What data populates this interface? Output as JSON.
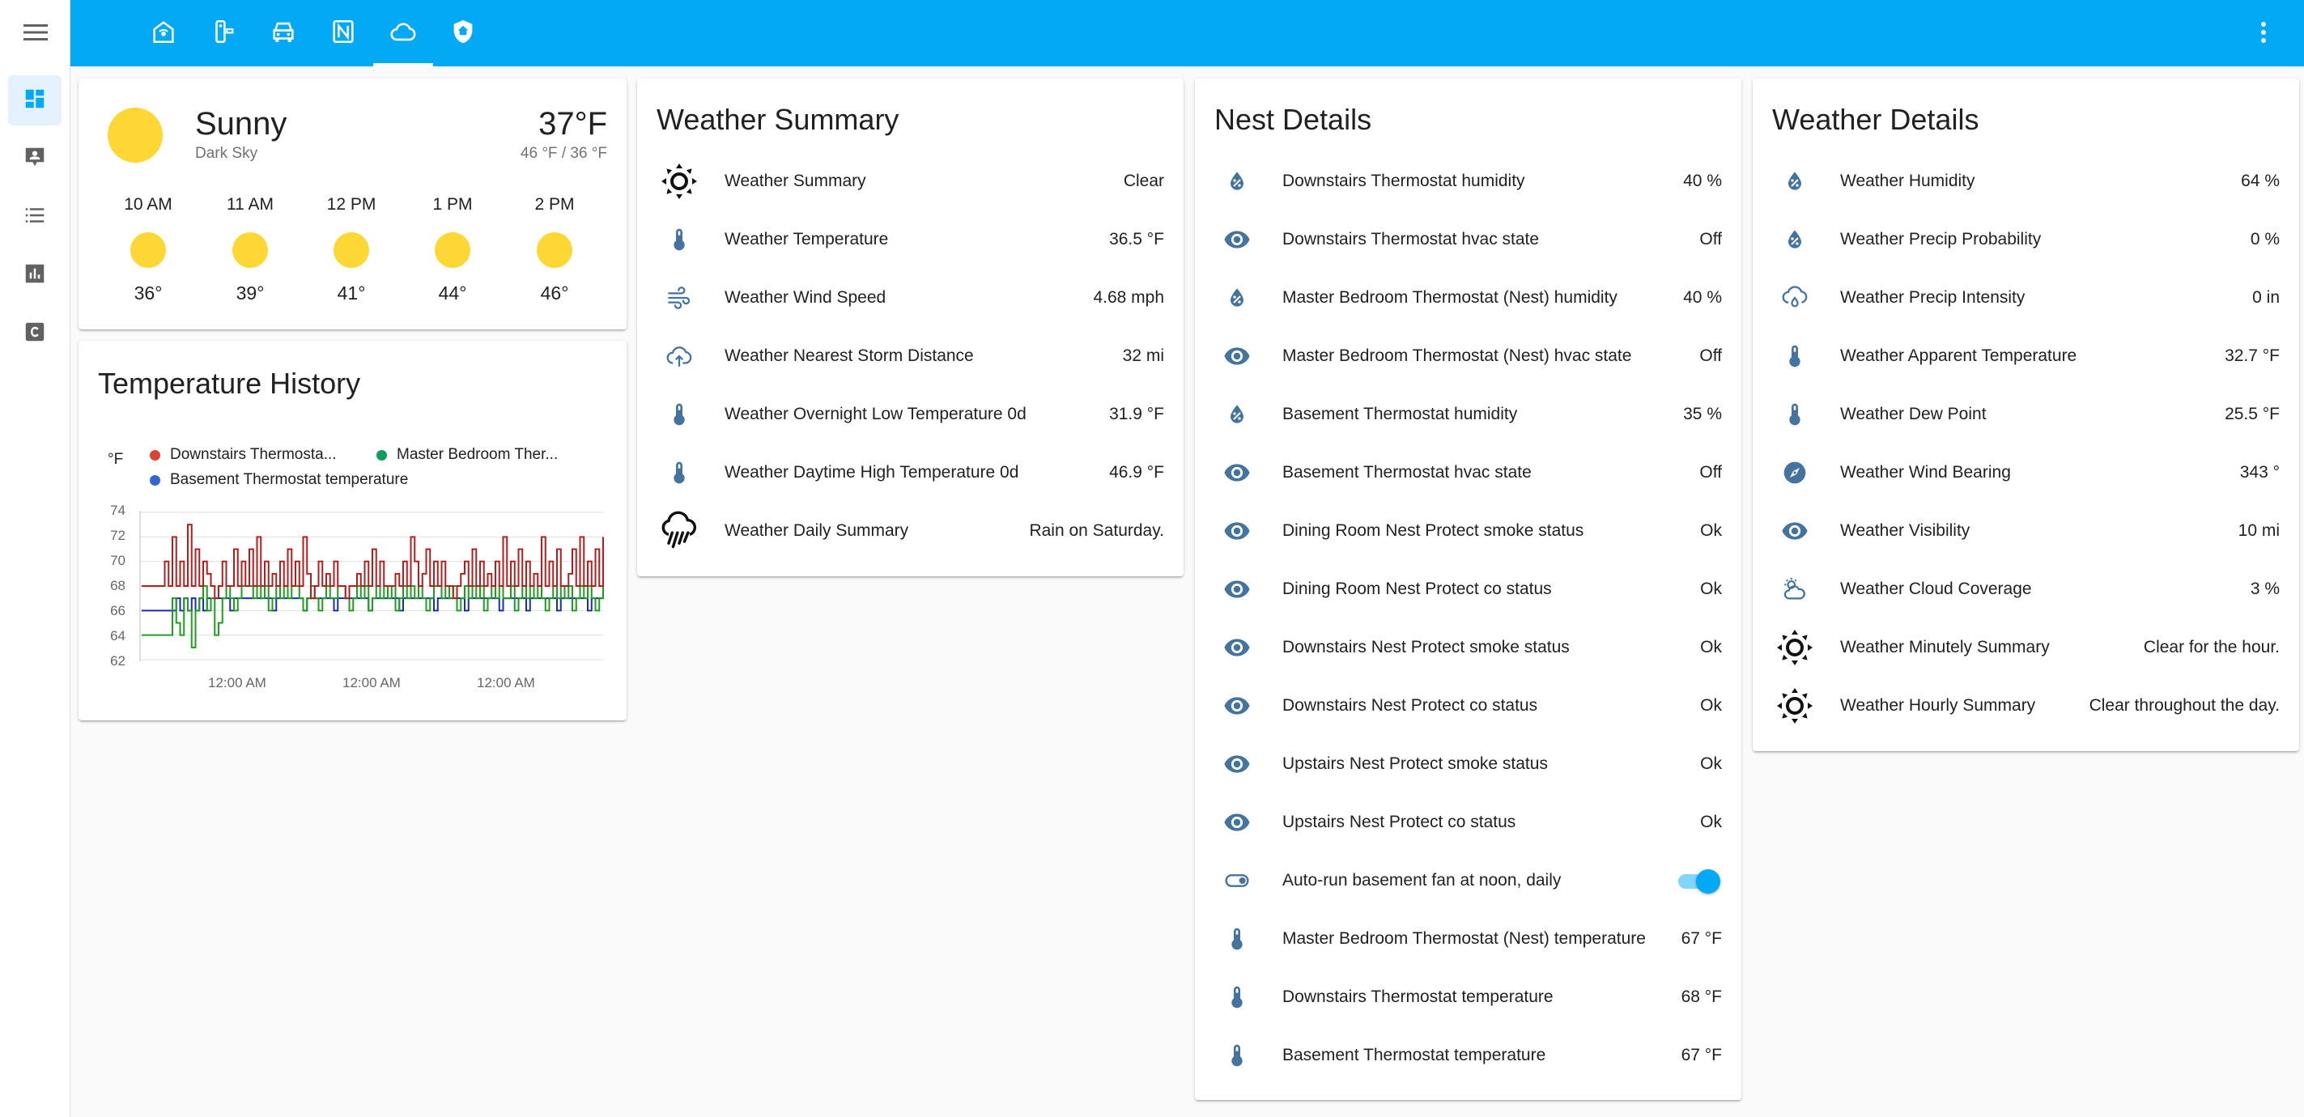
{
  "header": {
    "tabs": [
      {
        "icon": "home-automation-icon",
        "active": false
      },
      {
        "icon": "remote-icon",
        "active": false
      },
      {
        "icon": "car-icon",
        "active": false
      },
      {
        "icon": "nfc-icon",
        "active": false
      },
      {
        "icon": "cloud-icon",
        "active": true
      },
      {
        "icon": "shield-home-icon",
        "active": false
      }
    ]
  },
  "sidebar": {
    "items": [
      {
        "icon": "dashboard-icon",
        "active": true
      },
      {
        "icon": "account-box-icon",
        "active": false
      },
      {
        "icon": "list-icon",
        "active": false
      },
      {
        "icon": "chart-bar-icon",
        "active": false
      },
      {
        "icon": "letter-c-icon",
        "active": false
      }
    ]
  },
  "weather_forecast": {
    "state": "Sunny",
    "attribution": "Dark Sky",
    "temperature": "37°F",
    "hilo": "46 °F / 36 °F",
    "forecast": [
      {
        "time": "10 AM",
        "temp": "36°"
      },
      {
        "time": "11 AM",
        "temp": "39°"
      },
      {
        "time": "12 PM",
        "temp": "41°"
      },
      {
        "time": "1 PM",
        "temp": "44°"
      },
      {
        "time": "2 PM",
        "temp": "46°"
      }
    ]
  },
  "temperature_history": {
    "title": "Temperature History",
    "unit": "°F",
    "legend": [
      {
        "name": "Downstairs Thermosta...",
        "color": "#db4437"
      },
      {
        "name": "Master Bedroom Ther...",
        "color": "#0f9d58"
      },
      {
        "name": "Basement Thermostat temperature",
        "color": "#3366cc"
      }
    ]
  },
  "chart_data": {
    "type": "line",
    "ylim": [
      62,
      74
    ],
    "yticks": [
      "74",
      "72",
      "70",
      "68",
      "66",
      "64",
      "62"
    ],
    "xticks": [
      "12:00 AM",
      "12:00 AM",
      "12:00 AM"
    ],
    "series": [
      {
        "name": "Downstairs Thermosta...",
        "color": "#b71c1c",
        "values": [
          68,
          68,
          68,
          68,
          68,
          68,
          70,
          68,
          72,
          68,
          70,
          68,
          73,
          68,
          71,
          68,
          70,
          69,
          68,
          67,
          68,
          70,
          68,
          68,
          71,
          68,
          70,
          68,
          71,
          68,
          72,
          68,
          70,
          68,
          69,
          68,
          70,
          68,
          71,
          68,
          70,
          68,
          72,
          69,
          67,
          68,
          70,
          68,
          69,
          68,
          70,
          68,
          68,
          67,
          68,
          68,
          69,
          68,
          70,
          68,
          71,
          68,
          70,
          68,
          68,
          68,
          69,
          68,
          70,
          68,
          72,
          70,
          68,
          69,
          71,
          68,
          70,
          68,
          70,
          68,
          68,
          67,
          68,
          69,
          70,
          68,
          71,
          68,
          70,
          68,
          69,
          68,
          70,
          68,
          72,
          68,
          70,
          68,
          71,
          68,
          70,
          68,
          69,
          68,
          72,
          68,
          70,
          68,
          71,
          68,
          68,
          69,
          71,
          68,
          72,
          68,
          70,
          68,
          71,
          68,
          72
        ]
      },
      {
        "name": "Master Bedroom Ther...",
        "color": "#1e9e1e",
        "values": [
          64,
          64,
          64,
          64,
          64,
          64,
          64,
          64,
          67,
          65,
          64,
          67,
          66,
          63,
          66,
          67,
          68,
          66,
          67,
          64,
          65,
          67,
          68,
          67,
          66,
          67,
          68,
          68,
          68,
          67,
          68,
          67,
          68,
          66,
          67,
          68,
          67,
          68,
          67,
          68,
          68,
          67,
          66,
          67,
          68,
          67,
          66,
          67,
          68,
          67,
          67,
          68,
          68,
          67,
          66,
          67,
          68,
          67,
          68,
          66,
          67,
          68,
          67,
          68,
          67,
          68,
          66,
          67,
          68,
          67,
          68,
          67,
          68,
          67,
          66,
          67,
          68,
          68,
          67,
          68,
          67,
          68,
          66,
          67,
          68,
          67,
          68,
          67,
          68,
          66,
          67,
          68,
          67,
          68,
          67,
          67,
          68,
          66,
          67,
          68,
          67,
          68,
          67,
          68,
          67,
          66,
          67,
          68,
          67,
          68,
          67,
          68,
          66,
          67,
          68,
          67,
          68,
          67,
          66,
          67,
          68
        ]
      },
      {
        "name": "Basement Thermostat temperature",
        "color": "#1a2bb5",
        "values": [
          66,
          66,
          66,
          66,
          66,
          66,
          66,
          66,
          66,
          67,
          66,
          67,
          66,
          67,
          66,
          67,
          66,
          67,
          67,
          67,
          67,
          67,
          67,
          66,
          67,
          67,
          67,
          67,
          67,
          67,
          67,
          67,
          67,
          67,
          66,
          67,
          67,
          67,
          67,
          67,
          67,
          67,
          66,
          67,
          67,
          67,
          67,
          67,
          67,
          67,
          66,
          67,
          67,
          67,
          67,
          67,
          67,
          67,
          67,
          66,
          67,
          67,
          67,
          67,
          67,
          67,
          67,
          66,
          67,
          67,
          67,
          67,
          67,
          67,
          67,
          67,
          66,
          67,
          67,
          67,
          67,
          67,
          67,
          67,
          66,
          67,
          67,
          67,
          67,
          67,
          67,
          67,
          67,
          66,
          67,
          67,
          67,
          67,
          67,
          67,
          66,
          67,
          67,
          67,
          67,
          67,
          67,
          67,
          66,
          67,
          67,
          67,
          67,
          67,
          67,
          67,
          66,
          67,
          67,
          67,
          67
        ]
      }
    ]
  },
  "weather_summary": {
    "title": "Weather Summary",
    "rows": [
      {
        "icon": "sunny-icon",
        "name": "Weather Summary",
        "value": "Clear"
      },
      {
        "icon": "thermometer-icon",
        "name": "Weather Temperature",
        "value": "36.5 °F"
      },
      {
        "icon": "wind-icon",
        "name": "Weather Wind Speed",
        "value": "4.68 mph"
      },
      {
        "icon": "cloud-upload-icon",
        "name": "Weather Nearest Storm Distance",
        "value": "32 mi"
      },
      {
        "icon": "thermometer-icon",
        "name": "Weather Overnight Low Temperature 0d",
        "value": "31.9 °F"
      },
      {
        "icon": "thermometer-icon",
        "name": "Weather Daytime High Temperature 0d",
        "value": "46.9 °F"
      },
      {
        "icon": "rainy-icon",
        "name": "Weather Daily Summary",
        "value": "Rain on Saturday."
      }
    ]
  },
  "nest_details": {
    "title": "Nest Details",
    "rows": [
      {
        "icon": "water-percent-icon",
        "name": "Downstairs Thermostat humidity",
        "value": "40 %"
      },
      {
        "icon": "eye-icon",
        "name": "Downstairs Thermostat hvac state",
        "value": "Off"
      },
      {
        "icon": "water-percent-icon",
        "name": "Master Bedroom Thermostat (Nest) humidity",
        "value": "40 %"
      },
      {
        "icon": "eye-icon",
        "name": "Master Bedroom Thermostat (Nest) hvac state",
        "value": "Off"
      },
      {
        "icon": "water-percent-icon",
        "name": "Basement Thermostat humidity",
        "value": "35 %"
      },
      {
        "icon": "eye-icon",
        "name": "Basement Thermostat hvac state",
        "value": "Off"
      },
      {
        "icon": "eye-icon",
        "name": "Dining Room Nest Protect smoke status",
        "value": "Ok"
      },
      {
        "icon": "eye-icon",
        "name": "Dining Room Nest Protect co status",
        "value": "Ok"
      },
      {
        "icon": "eye-icon",
        "name": "Downstairs Nest Protect smoke status",
        "value": "Ok"
      },
      {
        "icon": "eye-icon",
        "name": "Downstairs Nest Protect co status",
        "value": "Ok"
      },
      {
        "icon": "eye-icon",
        "name": "Upstairs Nest Protect smoke status",
        "value": "Ok"
      },
      {
        "icon": "eye-icon",
        "name": "Upstairs Nest Protect co status",
        "value": "Ok"
      },
      {
        "icon": "toggle-switch-icon",
        "name": "Auto-run basement fan at noon, daily",
        "value": "",
        "toggle": true
      },
      {
        "icon": "thermometer-icon",
        "name": "Master Bedroom Thermostat (Nest) temperature",
        "value": "67 °F"
      },
      {
        "icon": "thermometer-icon",
        "name": "Downstairs Thermostat temperature",
        "value": "68 °F"
      },
      {
        "icon": "thermometer-icon",
        "name": "Basement Thermostat temperature",
        "value": "67 °F"
      }
    ]
  },
  "weather_details": {
    "title": "Weather Details",
    "rows": [
      {
        "icon": "water-percent-icon",
        "name": "Weather Humidity",
        "value": "64 %"
      },
      {
        "icon": "water-percent-icon",
        "name": "Weather Precip Probability",
        "value": "0 %"
      },
      {
        "icon": "weather-rainy-icon",
        "name": "Weather Precip Intensity",
        "value": "0 in"
      },
      {
        "icon": "thermometer-icon",
        "name": "Weather Apparent Temperature",
        "value": "32.7 °F"
      },
      {
        "icon": "thermometer-icon",
        "name": "Weather Dew Point",
        "value": "25.5 °F"
      },
      {
        "icon": "compass-icon",
        "name": "Weather Wind Bearing",
        "value": "343 °"
      },
      {
        "icon": "eye-icon",
        "name": "Weather Visibility",
        "value": "10 mi"
      },
      {
        "icon": "partly-cloudy-icon",
        "name": "Weather Cloud Coverage",
        "value": "3 %"
      },
      {
        "icon": "sunny-icon",
        "name": "Weather Minutely Summary",
        "value": "Clear for the hour."
      },
      {
        "icon": "sunny-icon",
        "name": "Weather Hourly Summary",
        "value": "Clear throughout the day."
      }
    ]
  },
  "colors": {
    "header": "#03a9f4",
    "icon": "#44739e",
    "sun": "#fdd835",
    "toggle_on": "#03a9f4"
  }
}
